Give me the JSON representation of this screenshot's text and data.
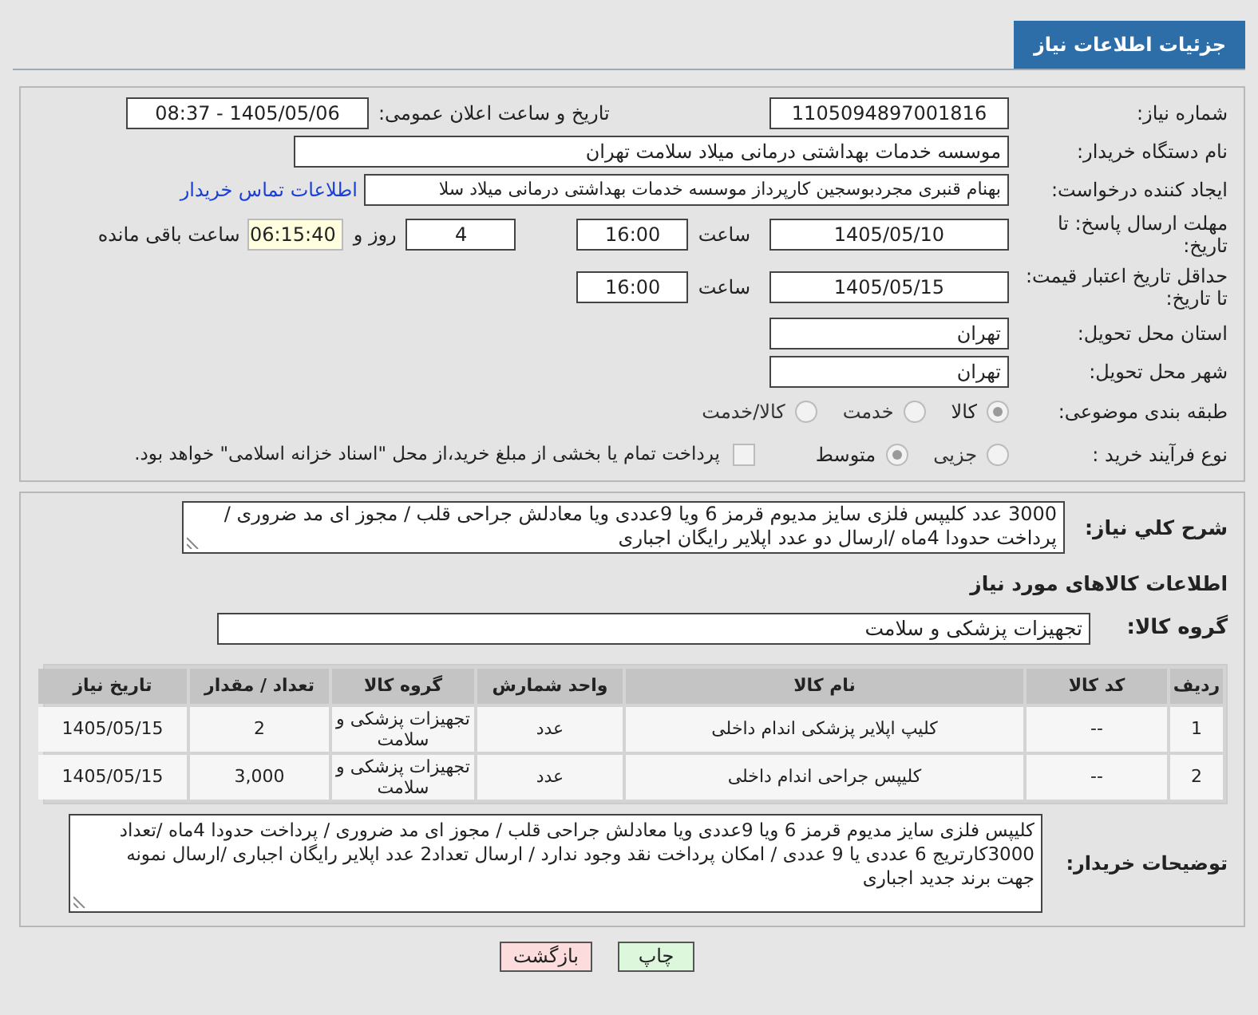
{
  "header_tab": "جزئیات اطلاعات نیاز",
  "need_number": {
    "label": "شماره نیاز:",
    "value": "1105094897001816"
  },
  "announce": {
    "label": "تاریخ و ساعت اعلان عمومی:",
    "value": "1405/05/06 - 08:37"
  },
  "buyer_org": {
    "label": "نام دستگاه خریدار:",
    "value": "موسسه خدمات بهداشتی درمانی میلاد سلامت تهران"
  },
  "requester": {
    "label": "ایجاد کننده درخواست:",
    "value": "بهنام قنبری مجردبوسجین کارپرداز موسسه خدمات بهداشتی درمانی میلاد سلا",
    "link": "اطلاعات تماس خریدار"
  },
  "deadline": {
    "label": "مهلت ارسال پاسخ: تا تاریخ:",
    "date": "1405/05/10",
    "time_label": "ساعت",
    "time": "16:00",
    "days": "4",
    "days_label": "روز و",
    "remaining": "06:15:40",
    "remaining_label": "ساعت باقی مانده"
  },
  "validity": {
    "label": "حداقل تاریخ اعتبار قیمت: تا تاریخ:",
    "date": "1405/05/15",
    "time_label": "ساعت",
    "time": "16:00"
  },
  "province": {
    "label": "استان محل تحویل:",
    "value": "تهران"
  },
  "city": {
    "label": "شهر محل تحویل:",
    "value": "تهران"
  },
  "category": {
    "label": "طبقه بندی موضوعی:",
    "options": [
      {
        "label": "کالا",
        "selected": true
      },
      {
        "label": "خدمت",
        "selected": false
      },
      {
        "label": "کالا/خدمت",
        "selected": false
      }
    ]
  },
  "process": {
    "label": "نوع فرآیند خرید :",
    "options": [
      {
        "label": "جزیی",
        "selected": false
      },
      {
        "label": "متوسط",
        "selected": true
      }
    ],
    "treasury": {
      "label": "پرداخت تمام یا بخشی از مبلغ خرید،از محل \"اسناد خزانه اسلامی\" خواهد بود.",
      "checked": false
    }
  },
  "description": {
    "label": "شرح کلي نیاز:",
    "value": "3000 عدد کلیپس فلزی سایز مدیوم قرمز 6 ویا 9عددی ویا معادلش جراحی قلب / مجوز ای مد ضروری / پرداخت   حدودا  4ماه  /ارسال دو عدد اپلایر رایگان اجباری"
  },
  "goods_title": "اطلاعات کالاهای مورد نیاز",
  "goods_group": {
    "label": "گروه کالا:",
    "value": "تجهیزات پزشکی و سلامت"
  },
  "table": {
    "columns": [
      "ردیف",
      "کد کالا",
      "نام کالا",
      "واحد شمارش",
      "گروه کالا",
      "تعداد / مقدار",
      "تاریخ نیاز"
    ],
    "rows": [
      [
        "1",
        "--",
        "کلیپ اپلایر پزشکی اندام داخلی",
        "عدد",
        "تجهیزات پزشکی و سلامت",
        "2",
        "1405/05/15"
      ],
      [
        "2",
        "--",
        "کلیپس جراحی اندام داخلی",
        "عدد",
        "تجهیزات پزشکی و سلامت",
        "3,000",
        "1405/05/15"
      ]
    ]
  },
  "buyer_notes": {
    "label": "توضیحات خریدار:",
    "value": "کلیپس فلزی سایز مدیوم قرمز 6 ویا 9عددی ویا معادلش جراحی قلب / مجوز ای مد ضروری / پرداخت   حدودا  4ماه  /تعداد 3000کارتریج 6 عددی یا 9 عددی  / امکان پرداخت نقد وجود ندارد / ارسال تعداد2 عدد اپلایر رایگان اجباری /ارسال نمونه جهت برند جدید اجباری"
  },
  "buttons": [
    {
      "kind": "print",
      "label": "چاپ"
    },
    {
      "kind": "back",
      "label": "بازگشت"
    }
  ]
}
